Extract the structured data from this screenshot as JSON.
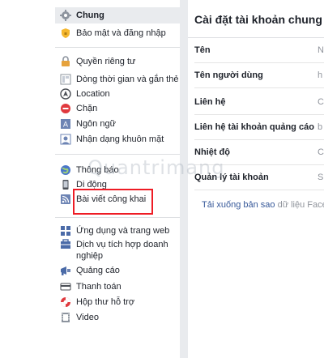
{
  "sidebar": {
    "items": [
      {
        "label": "Chung",
        "icon": "gear-icon"
      },
      {
        "label": "Bảo mật và đăng nhập",
        "icon": "shield-icon"
      },
      {
        "label": "Quyền riêng tư",
        "icon": "lock-icon"
      },
      {
        "label": "Dòng thời gian và gắn thẻ",
        "icon": "timeline-icon"
      },
      {
        "label": "Location",
        "icon": "location-icon"
      },
      {
        "label": "Chặn",
        "icon": "block-icon"
      },
      {
        "label": "Ngôn ngữ",
        "icon": "language-icon"
      },
      {
        "label": "Nhận dạng khuôn mặt",
        "icon": "face-recognition-icon"
      },
      {
        "label": "Thông báo",
        "icon": "globe-icon"
      },
      {
        "label": "Di động",
        "icon": "mobile-icon"
      },
      {
        "label": "Bài viết công khai",
        "icon": "rss-icon"
      },
      {
        "label": "Ứng dụng và trang web",
        "icon": "apps-icon"
      },
      {
        "label": "Dịch vụ tích hợp doanh nghiệp",
        "icon": "business-icon"
      },
      {
        "label": "Quảng cáo",
        "icon": "ads-icon"
      },
      {
        "label": "Thanh toán",
        "icon": "payment-icon"
      },
      {
        "label": "Hộp thư hỗ trợ",
        "icon": "support-lifebuoy-icon"
      },
      {
        "label": "Video",
        "icon": "video-icon"
      }
    ]
  },
  "main": {
    "title": "Cài đặt tài khoản chung",
    "rows": [
      {
        "label": "Tên",
        "value": "N"
      },
      {
        "label": "Tên người dùng",
        "value": "h"
      },
      {
        "label": "Liên hệ",
        "value": "Ch"
      },
      {
        "label": "Liên hệ tài khoản quảng cáo",
        "value": "b"
      },
      {
        "label": "Nhiệt độ",
        "value": "C"
      },
      {
        "label": "Quản lý tài khoản",
        "value": "S"
      }
    ],
    "download_link": "Tải xuống bản sao",
    "download_rest": " dữ liệu Faceb"
  },
  "watermark": "Quantrimang",
  "colors": {
    "link": "#365899",
    "highlight_box": "#ee1c25",
    "active_bg": "#e9ebee"
  }
}
